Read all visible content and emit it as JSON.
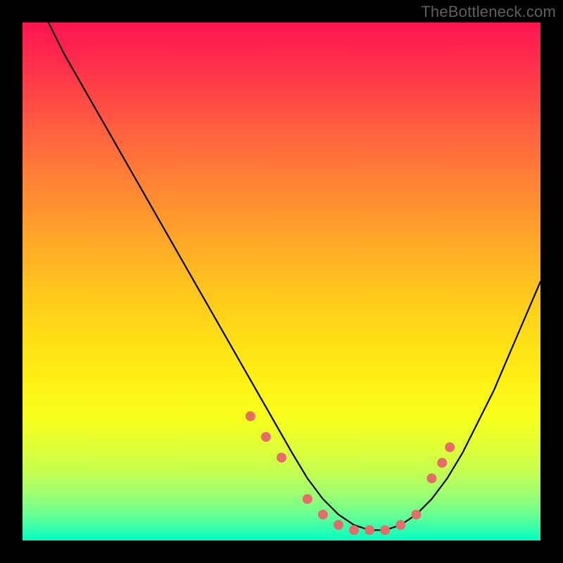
{
  "attribution": "TheBottleneck.com",
  "chart_data": {
    "type": "line",
    "title": "",
    "xlabel": "",
    "ylabel": "",
    "xlim": [
      0,
      100
    ],
    "ylim": [
      0,
      100
    ],
    "series": [
      {
        "name": "bottleneck-curve",
        "x": [
          5,
          8,
          12,
          16,
          20,
          24,
          28,
          32,
          36,
          40,
          44,
          48,
          52,
          55,
          58,
          61,
          64,
          67,
          70,
          73,
          76,
          79,
          82,
          85,
          88,
          91,
          94,
          97,
          100
        ],
        "y": [
          100,
          94,
          87,
          80,
          73,
          66,
          59,
          52,
          45,
          38,
          31,
          24,
          17,
          12,
          8,
          5,
          3,
          2,
          2,
          3,
          5,
          8,
          12,
          17,
          23,
          29,
          36,
          43,
          50
        ]
      }
    ],
    "markers": {
      "name": "highlighted-points",
      "color": "#e86a6a",
      "radius": 7,
      "x": [
        44,
        47,
        50,
        55,
        58,
        61,
        64,
        67,
        70,
        73,
        76,
        79,
        81,
        82.5
      ],
      "y": [
        24,
        20,
        16,
        8,
        5,
        3,
        2,
        2,
        2,
        3,
        5,
        12,
        15,
        18
      ]
    },
    "gradient_stops": [
      {
        "pos": 0.0,
        "color": "#ff1450"
      },
      {
        "pos": 0.5,
        "color": "#ffd61a"
      },
      {
        "pos": 0.9,
        "color": "#b8ff5c"
      },
      {
        "pos": 1.0,
        "color": "#00ffbf"
      }
    ]
  }
}
